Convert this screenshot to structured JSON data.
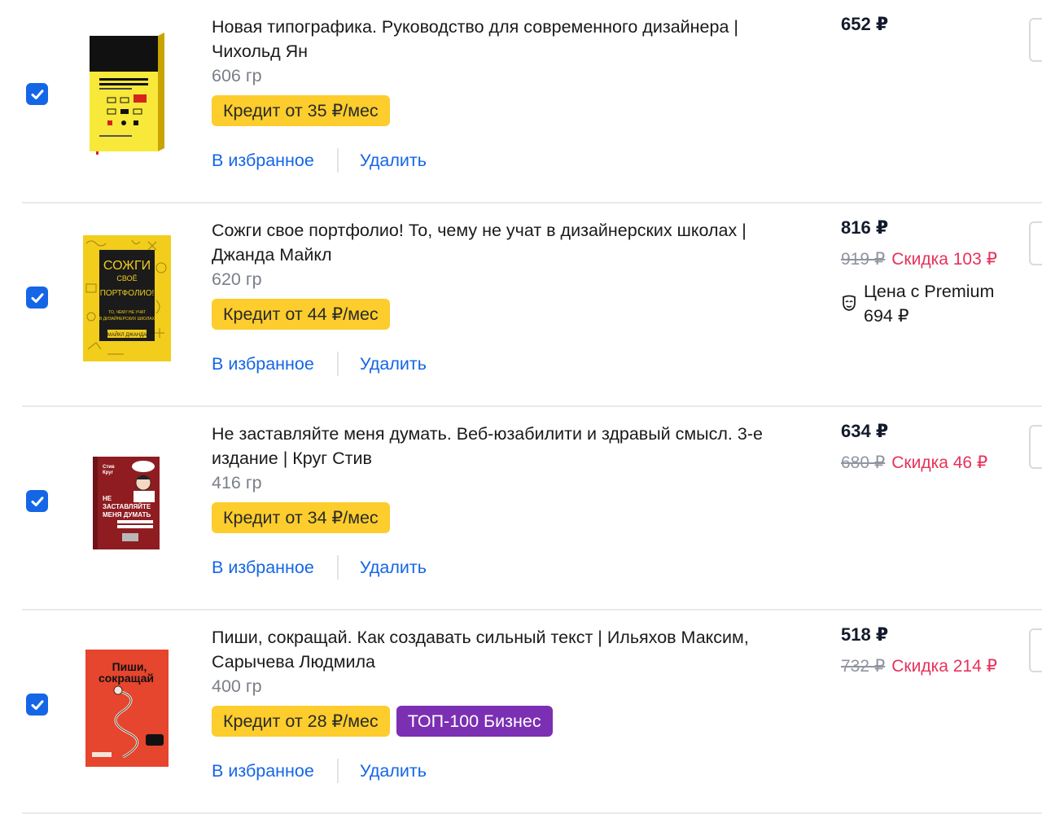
{
  "cart": {
    "items": [
      {
        "title": "Новая типографика. Руководство для современного дизайнера | Чихольд Ян",
        "weight": "606 гр",
        "credit": "Кредит от 35 ₽/мес",
        "favorite": "В избранное",
        "remove": "Удалить",
        "price": "652 ₽",
        "checked": true
      },
      {
        "title": "Сожги свое портфолио! То, чему не учат в дизайнерских школах | Джанда Майкл",
        "weight": "620 гр",
        "credit": "Кредит от 44 ₽/мес",
        "favorite": "В избранное",
        "remove": "Удалить",
        "price": "816 ₽",
        "old_price": "919 ₽",
        "discount": "Скидка 103 ₽",
        "premium_label": "Цена с Premium",
        "premium_price": "694 ₽",
        "checked": true,
        "cover": {
          "title_line1": "СОЖГИ",
          "title_line2": "СВОЁ",
          "title_line3": "ПОРТФОЛИО!",
          "subtitle_line1": "ТО, ЧЕМУ НЕ УЧАТ",
          "subtitle_line2": "В ДИЗАЙНЕРСКИХ ШКОЛАХ",
          "author": "МАЙКЛ ДЖАНДА"
        }
      },
      {
        "title": "Не заставляйте меня думать. Веб-юзабилити и здравый смысл. 3-е издание | Круг Стив",
        "weight": "416 гр",
        "credit": "Кредит от 34 ₽/мес",
        "favorite": "В избранное",
        "remove": "Удалить",
        "price": "634 ₽",
        "old_price": "680 ₽",
        "discount": "Скидка 46 ₽",
        "checked": true,
        "cover": {
          "author_line1": "Стив",
          "author_line2": "Круг",
          "title_line1": "НЕ",
          "title_line2": "ЗАСТАВЛЯЙТЕ",
          "title_line3": "МЕНЯ ДУМАТЬ"
        }
      },
      {
        "title": "Пиши, сокращай. Как создавать сильный текст | Ильяхов Максим, Сарычева Людмила",
        "weight": "400 гр",
        "credit": "Кредит от 28 ₽/мес",
        "badge": "ТОП-100 Бизнес",
        "favorite": "В избранное",
        "remove": "Удалить",
        "price": "518 ₽",
        "old_price": "732 ₽",
        "discount": "Скидка 214 ₽",
        "checked": true,
        "cover": {
          "title_line1": "Пиши,",
          "title_line2": "сокращай"
        }
      }
    ]
  },
  "colors": {
    "accent": "#1466e6",
    "credit_bg": "#fccd2c",
    "top100_bg": "#7b2fb3",
    "discount": "#e8315b",
    "old_price": "#8f95a0",
    "weight": "#7a7f88"
  },
  "icons": {
    "checkbox": "check-icon",
    "premium": "premium-mask-icon"
  }
}
